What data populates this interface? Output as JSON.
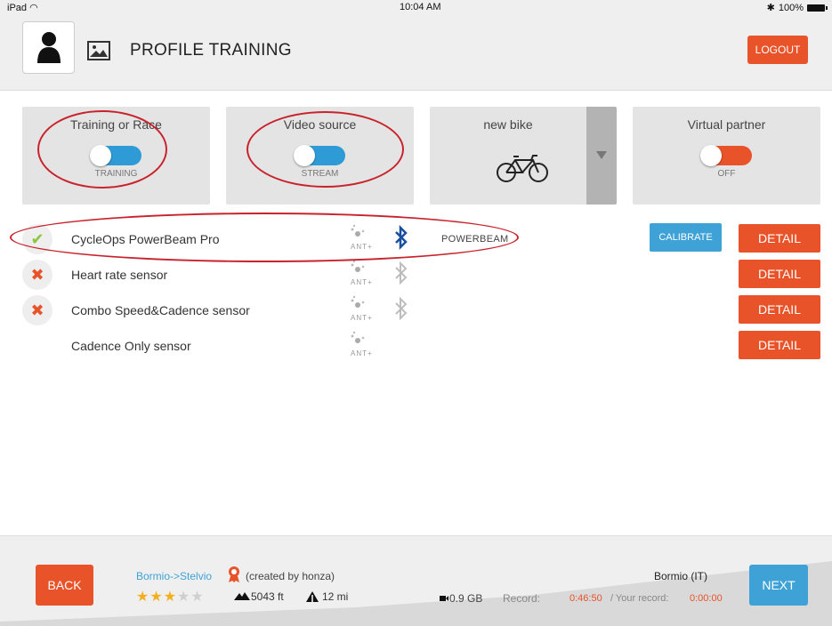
{
  "status_bar": {
    "device": "iPad",
    "time": "10:04 AM",
    "battery": "100%"
  },
  "header": {
    "title": "PROFILE TRAINING",
    "logout_label": "LOGOUT",
    "avatar_icon": "user-silhouette-icon",
    "picture_icon": "image-icon"
  },
  "settings": {
    "training_or_race": {
      "title": "Training or Race",
      "value": "TRAINING"
    },
    "video_source": {
      "title": "Video source",
      "value": "STREAM"
    },
    "bike": {
      "title": "new bike",
      "icon": "bicycle-icon"
    },
    "virtual_partner": {
      "title": "Virtual partner",
      "value": "OFF"
    }
  },
  "devices": [
    {
      "name": "CycleOps PowerBeam Pro",
      "status": "connected",
      "ant_label": "ANT+",
      "bluetooth": "active",
      "type": "POWERBEAM",
      "calibrate_label": "CALIBRATE",
      "detail_label": "DETAIL"
    },
    {
      "name": "Heart rate sensor",
      "status": "disconnected",
      "ant_label": "ANT+",
      "bluetooth": "inactive",
      "detail_label": "DETAIL"
    },
    {
      "name": "Combo Speed&Cadence sensor",
      "status": "disconnected",
      "ant_label": "ANT+",
      "bluetooth": "inactive",
      "detail_label": "DETAIL"
    },
    {
      "name": "Cadence Only sensor",
      "status": "none",
      "ant_label": "ANT+",
      "detail_label": "DETAIL"
    }
  ],
  "footer": {
    "back_label": "BACK",
    "next_label": "NEXT",
    "route_name": "Bormio->Stelvio",
    "created_by": "(created by honza)",
    "rating": 3,
    "rating_max": 5,
    "elevation": "5043 ft",
    "distance": "12 mi",
    "location": "Bormio (IT)",
    "storage": "0.9 GB",
    "record_label": "Record:",
    "record_time": "0:46:50",
    "your_record_label": "/ Your record:",
    "your_record_time": "0:00:00"
  },
  "colors": {
    "accent_orange": "#e8532a",
    "accent_blue": "#3ea2d6",
    "annotation_red": "#c8232c",
    "check_green": "#8cc63f",
    "bluetooth_blue": "#1a4fa0"
  }
}
